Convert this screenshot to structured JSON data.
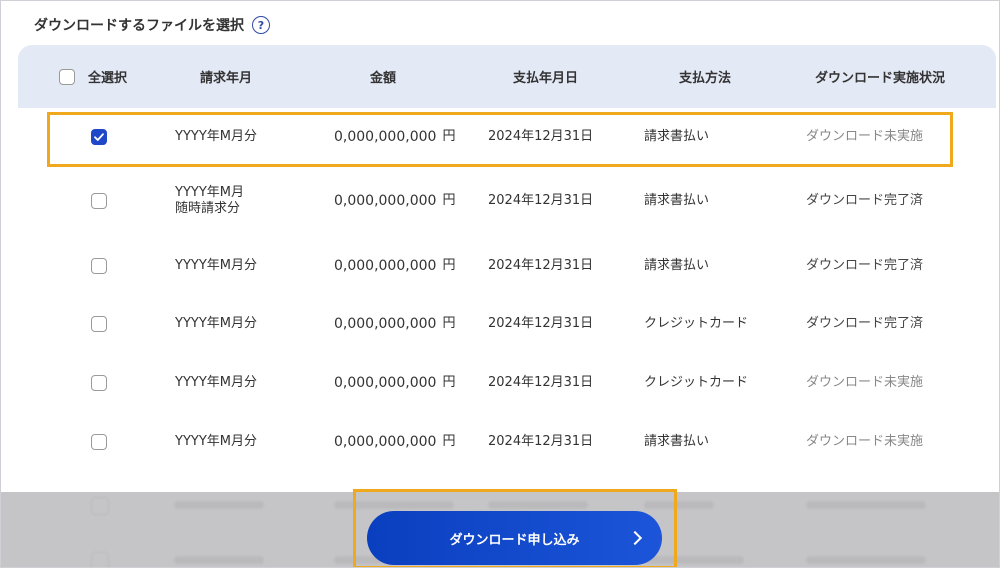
{
  "section": {
    "title": "ダウンロードするファイルを選択",
    "help_icon": "question-circle-icon"
  },
  "table": {
    "select_all_label": "全選択",
    "columns": {
      "billing_month": "請求年月",
      "amount": "金額",
      "payment_date": "支払年月日",
      "payment_method": "支払方法",
      "download_status": "ダウンロード実施状況"
    },
    "rows": [
      {
        "checked": true,
        "billing_month": "YYYY年M月分",
        "billing_month_line2": "",
        "amount": "0,000,000,000",
        "currency": "円",
        "payment_date": "2024年12月31日",
        "payment_method": "請求書払い",
        "status": "ダウンロード未実施"
      },
      {
        "checked": false,
        "billing_month": "YYYY年M月",
        "billing_month_line2": "随時請求分",
        "amount": "0,000,000,000",
        "currency": "円",
        "payment_date": "2024年12月31日",
        "payment_method": "請求書払い",
        "status": "ダウンロード完了済"
      },
      {
        "checked": false,
        "billing_month": "YYYY年M月分",
        "billing_month_line2": "",
        "amount": "0,000,000,000",
        "currency": "円",
        "payment_date": "2024年12月31日",
        "payment_method": "請求書払い",
        "status": "ダウンロード完了済"
      },
      {
        "checked": false,
        "billing_month": "YYYY年M月分",
        "billing_month_line2": "",
        "amount": "0,000,000,000",
        "currency": "円",
        "payment_date": "2024年12月31日",
        "payment_method": "クレジットカード",
        "status": "ダウンロード完了済"
      },
      {
        "checked": false,
        "billing_month": "YYYY年M月分",
        "billing_month_line2": "",
        "amount": "0,000,000,000",
        "currency": "円",
        "payment_date": "2024年12月31日",
        "payment_method": "クレジットカード",
        "status": "ダウンロード未実施"
      },
      {
        "checked": false,
        "billing_month": "YYYY年M月分",
        "billing_month_line2": "",
        "amount": "0,000,000,000",
        "currency": "円",
        "payment_date": "2024年12月31日",
        "payment_method": "請求書払い",
        "status": "ダウンロード未実施"
      }
    ]
  },
  "cta": {
    "label": "ダウンロード申し込み",
    "icon": "chevron-right-icon"
  },
  "colors": {
    "accent": "#1f48c9",
    "highlight": "#f0a81c",
    "header_bg": "#e4e9f6"
  }
}
